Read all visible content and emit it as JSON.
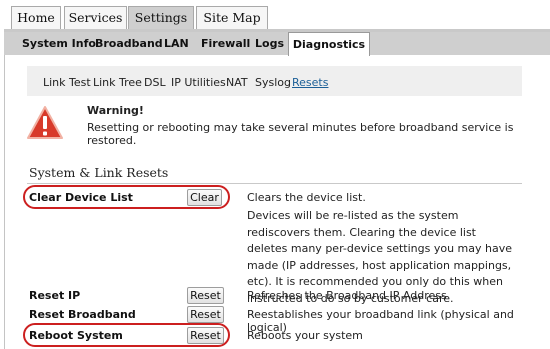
{
  "top_tabs": [
    {
      "label": "Home"
    },
    {
      "label": "Services"
    },
    {
      "label": "Settings",
      "active": true
    },
    {
      "label": "Site Map"
    }
  ],
  "sub_tabs": [
    {
      "label": "System Info"
    },
    {
      "label": "Broadband"
    },
    {
      "label": "LAN"
    },
    {
      "label": "Firewall"
    },
    {
      "label": "Logs"
    },
    {
      "label": "Diagnostics",
      "active": true
    }
  ],
  "third_tabs": [
    {
      "label": "Link Test"
    },
    {
      "label": "Link Tree"
    },
    {
      "label": "DSL"
    },
    {
      "label": "IP Utilities"
    },
    {
      "label": "NAT"
    },
    {
      "label": "Syslog"
    },
    {
      "label": "Resets",
      "active": true
    }
  ],
  "warning": {
    "title": "Warning!",
    "text": "Resetting or rebooting may take several minutes before broadband service is restored.",
    "icon": "warning-triangle-icon"
  },
  "section": {
    "title": "System & Link Resets"
  },
  "rows": [
    {
      "label": "Clear Device List",
      "button": "Clear",
      "description": "Clears the device list.",
      "detail": "Devices will be re-listed as the system rediscovers them. Clearing the device list deletes many per-device settings you may have made (IP addresses, host application mappings, etc). It is recommended you only do this when instructed to do so by customer care."
    },
    {
      "label": "Reset IP",
      "button": "Reset",
      "description": "Refreshes the Broadband IP Address"
    },
    {
      "label": "Reset Broadband",
      "button": "Reset",
      "description": "Reestablishes your broadband link (physical and logical)"
    },
    {
      "label": "Reboot System",
      "button": "Reset",
      "description": "Reboots your system"
    }
  ],
  "colors": {
    "active_link": "#1b5f97",
    "highlight_oval": "#cc1f1f",
    "warning_fill": "#d83a2a"
  }
}
